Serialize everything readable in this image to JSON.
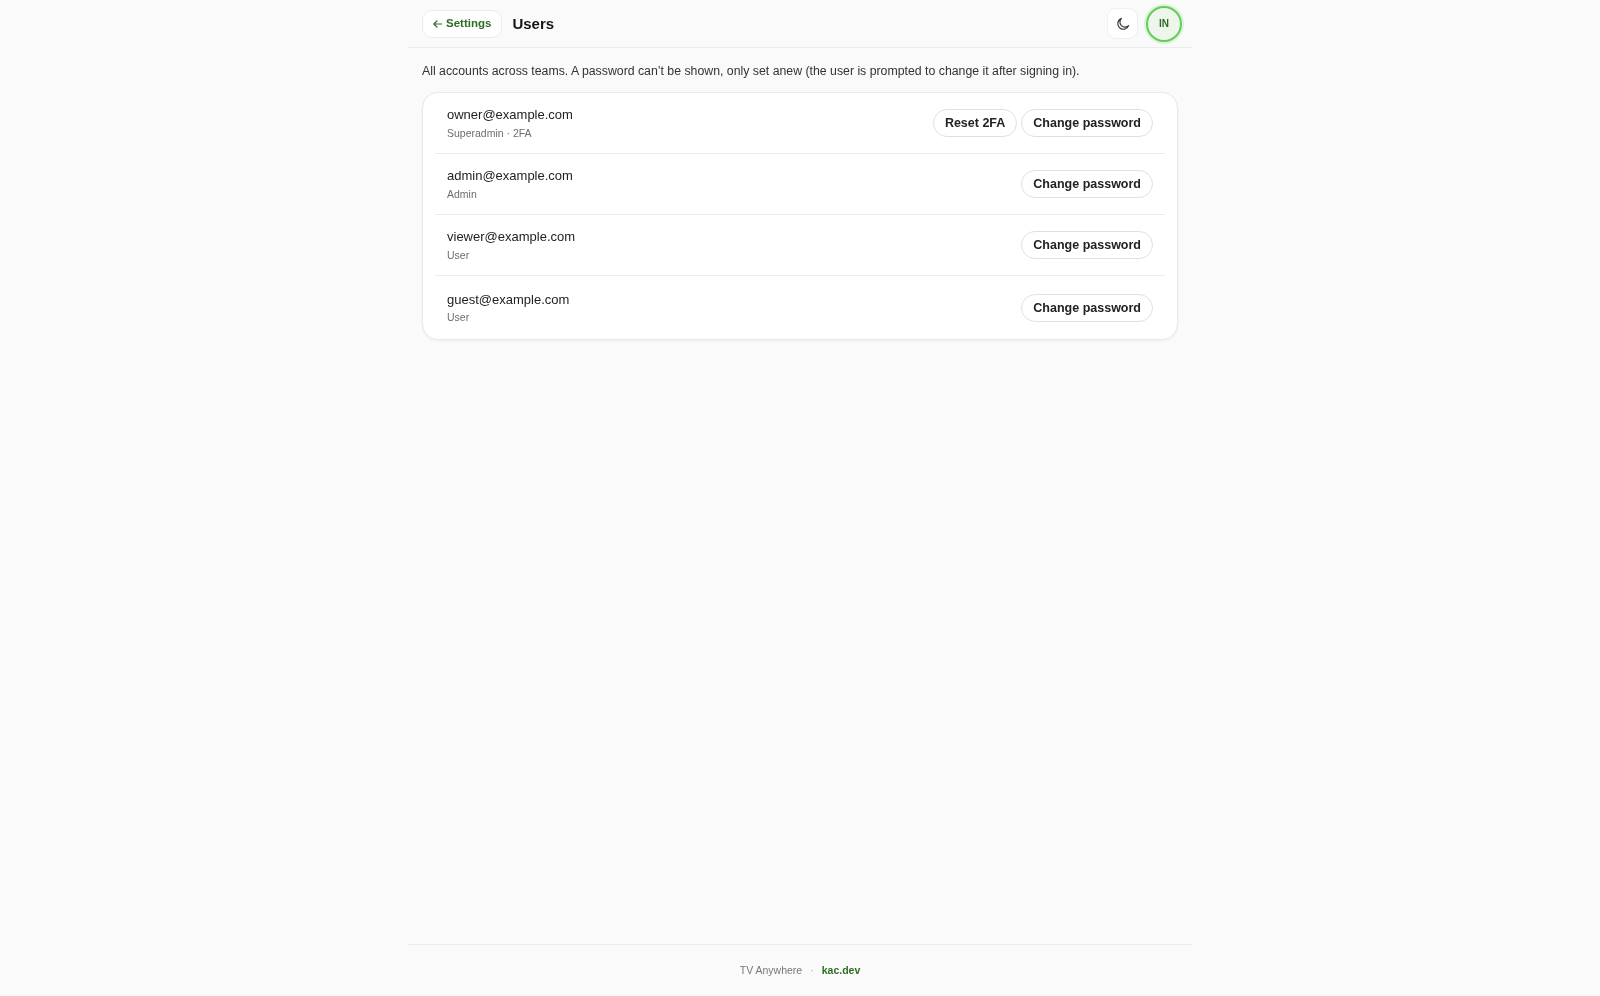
{
  "header": {
    "back_link": {
      "label": "Settings"
    },
    "title": "Users",
    "avatar": {
      "initials": "IN"
    }
  },
  "description": "All accounts across teams. A password can’t be shown, only set anew (the user is prompted to change it after signing in).",
  "users": [
    {
      "email": "owner@example.com",
      "meta": "Superadmin · 2FA",
      "actions": [
        "Reset 2FA",
        "Change password"
      ]
    },
    {
      "email": "admin@example.com",
      "meta": "Admin",
      "actions": [
        "Change password"
      ]
    },
    {
      "email": "viewer@example.com",
      "meta": "User",
      "actions": [
        "Change password"
      ]
    },
    {
      "email": "guest@example.com",
      "meta": "User",
      "actions": [
        "Change password"
      ]
    }
  ],
  "footer": {
    "app_name": "TV Anywhere",
    "separator": "·",
    "link": "kac.dev"
  }
}
